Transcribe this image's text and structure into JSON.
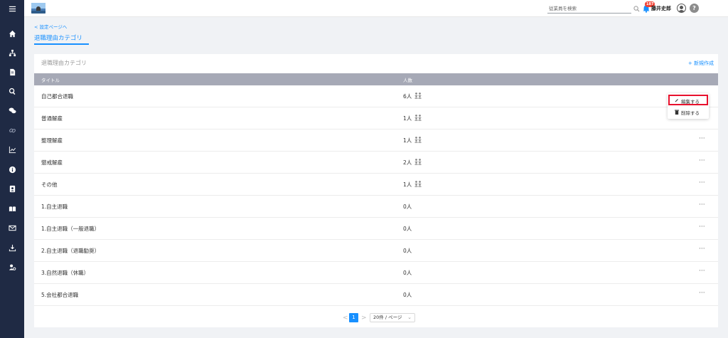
{
  "header": {
    "search_placeholder": "従業員を検索",
    "notification_count": "187",
    "username": "藤井史郎",
    "help": "?"
  },
  "sidebar": {
    "items": [
      {
        "icon": "home-icon"
      },
      {
        "icon": "org-chart-icon"
      },
      {
        "icon": "document-icon"
      },
      {
        "icon": "search-icon"
      },
      {
        "icon": "chat-icon"
      },
      {
        "icon": "link-icon"
      },
      {
        "icon": "chart-icon"
      },
      {
        "icon": "info-icon"
      },
      {
        "icon": "contact-card-icon"
      },
      {
        "icon": "book-icon"
      },
      {
        "icon": "mail-icon"
      },
      {
        "icon": "download-icon"
      },
      {
        "icon": "user-settings-icon"
      }
    ]
  },
  "breadcrumb": "< 設定ページへ",
  "page_title": "退職理由カテゴリ",
  "card": {
    "title": "退職理由カテゴリ",
    "new_button": "+ 新規作成"
  },
  "table": {
    "headers": [
      "タイトル",
      "人数"
    ],
    "rows": [
      {
        "title": "自己都合退職",
        "count": "6人",
        "has_people_icon": true
      },
      {
        "title": "普通解雇",
        "count": "1人",
        "has_people_icon": true
      },
      {
        "title": "整理解雇",
        "count": "1人",
        "has_people_icon": true
      },
      {
        "title": "懲戒解雇",
        "count": "2人",
        "has_people_icon": true
      },
      {
        "title": "その他",
        "count": "1人",
        "has_people_icon": true
      },
      {
        "title": "1.自主退職",
        "count": "0人",
        "has_people_icon": false
      },
      {
        "title": "1.自主退職（一般退職）",
        "count": "0人",
        "has_people_icon": false
      },
      {
        "title": "2.自主退職（退職勧奨）",
        "count": "0人",
        "has_people_icon": false
      },
      {
        "title": "3.自然退職（休職）",
        "count": "0人",
        "has_people_icon": false
      },
      {
        "title": "5.会社都合退職",
        "count": "0人",
        "has_people_icon": false
      }
    ],
    "more": "···"
  },
  "row_menu": {
    "edit": "編集する",
    "delete": "削除する"
  },
  "pagination": {
    "prev": "<",
    "current_page": "1",
    "next": ">",
    "page_size": "20件 / ページ"
  },
  "colors": {
    "sidebar": "#1f2a44",
    "accent": "#1890ff",
    "table_header": "#a6a9b6",
    "highlight": "#e8112d"
  }
}
